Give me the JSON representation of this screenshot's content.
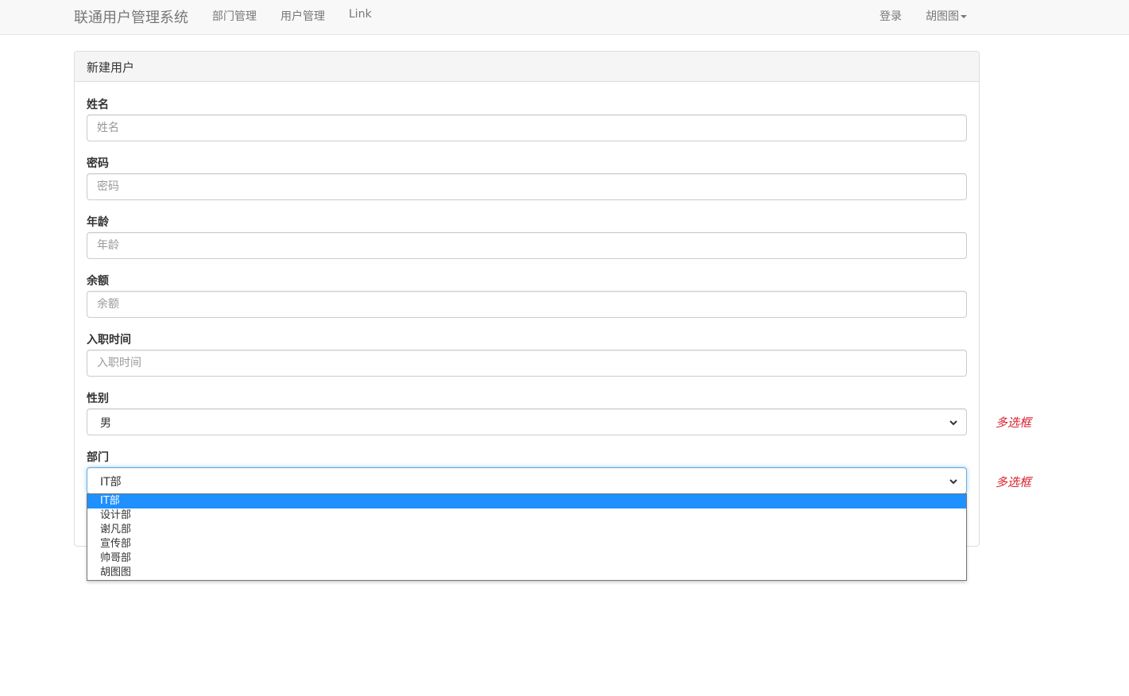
{
  "navbar": {
    "brand": "联通用户管理系统",
    "links": [
      "部门管理",
      "用户管理",
      "Link"
    ],
    "login": "登录",
    "profile": "胡图图"
  },
  "panel": {
    "title": "新建用户"
  },
  "form": {
    "name": {
      "label": "姓名",
      "placeholder": "姓名"
    },
    "password": {
      "label": "密码",
      "placeholder": "密码"
    },
    "age": {
      "label": "年龄",
      "placeholder": "年龄"
    },
    "balance": {
      "label": "余额",
      "placeholder": "余额"
    },
    "hire_date": {
      "label": "入职时间",
      "placeholder": "入职时间"
    },
    "gender": {
      "label": "性别",
      "value": "男",
      "hint": "多选框"
    },
    "department": {
      "label": "部门",
      "value": "IT部",
      "hint": "多选框",
      "options": [
        "IT部",
        "设计部",
        "谢凡部",
        "宣传部",
        "帅哥部",
        "胡图图"
      ],
      "selected_index": 0
    }
  },
  "colors": {
    "hint": "#d9232e",
    "option_highlight": "#1e90ff",
    "focus_border": "#66afe9"
  }
}
